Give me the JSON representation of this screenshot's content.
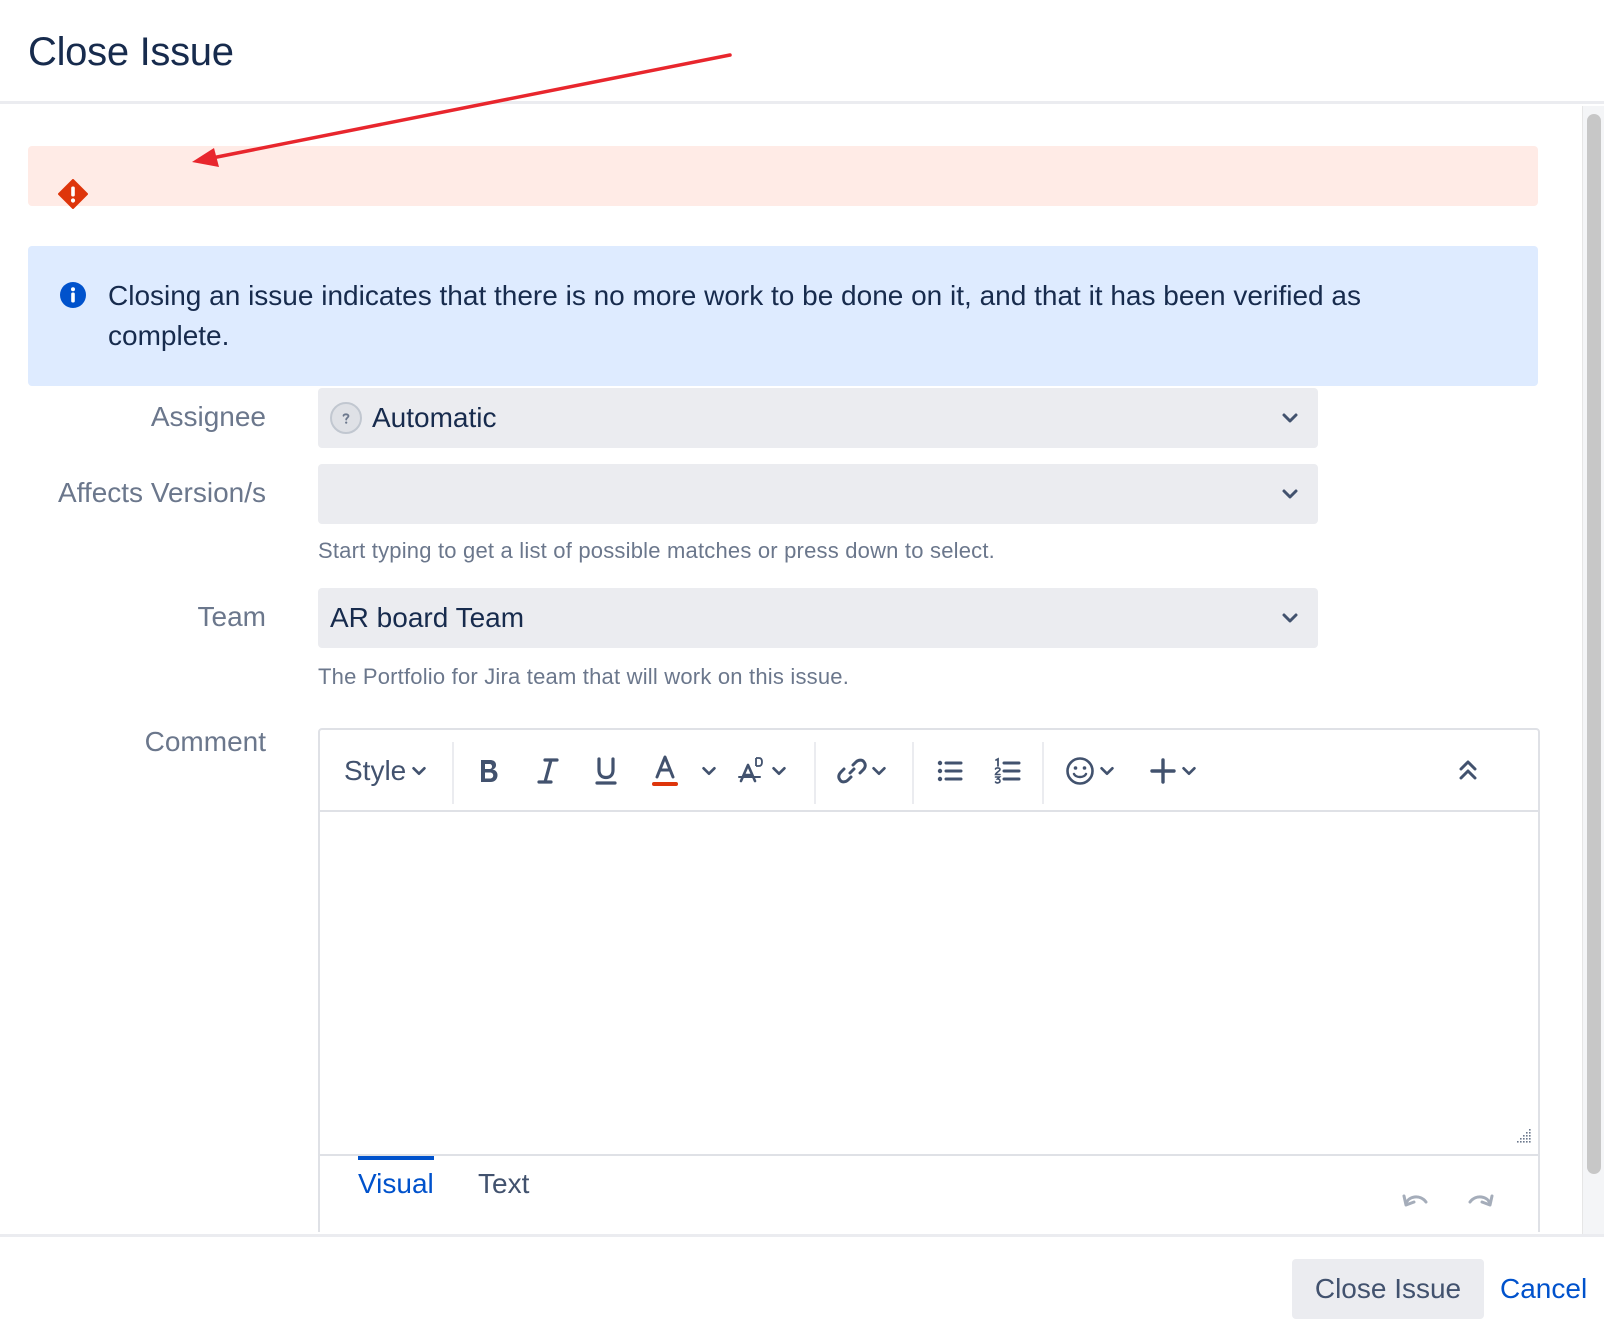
{
  "dialog": {
    "title": "Close Issue"
  },
  "info_banner": {
    "text": "Closing an issue indicates that there is no more work to be done on it, and that it has been verified as complete."
  },
  "fields": {
    "assignee": {
      "label": "Assignee",
      "value": "Automatic"
    },
    "affects_version": {
      "label": "Affects Version/s",
      "value": "",
      "help": "Start typing to get a list of possible matches or press down to select."
    },
    "team": {
      "label": "Team",
      "value": "AR board Team",
      "help": "The Portfolio for Jira team that will work on this issue."
    },
    "comment": {
      "label": "Comment"
    }
  },
  "editor": {
    "style_label": "Style",
    "tabs": {
      "visual": "Visual",
      "text": "Text"
    }
  },
  "footer": {
    "close_label": "Close Issue",
    "cancel_label": "Cancel"
  },
  "colors": {
    "error_bg": "#ffebe6",
    "error_icon": "#de350b",
    "info_bg": "#deebff",
    "info_icon": "#0052cc",
    "link": "#0052cc",
    "annotation_arrow": "#e8262d"
  }
}
